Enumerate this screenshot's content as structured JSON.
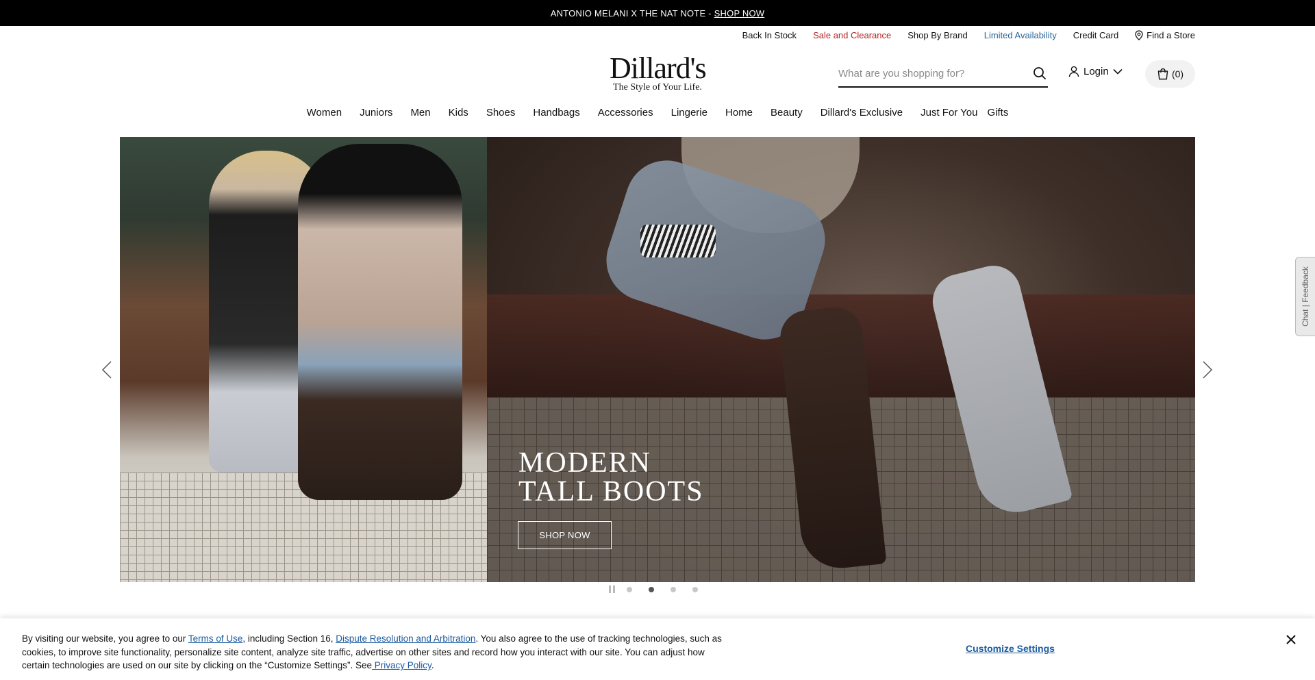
{
  "promo": {
    "text": "ANTONIO MELANI X THE NAT NOTE - ",
    "link": "SHOP NOW"
  },
  "utility": {
    "back_in_stock": "Back In Stock",
    "sale": "Sale and Clearance",
    "shop_by_brand": "Shop By Brand",
    "limited": "Limited Availability",
    "credit_card": "Credit Card",
    "find_store": "Find a Store"
  },
  "logo": {
    "wordmark": "Dillard's",
    "tagline": "The Style of Your Life."
  },
  "search": {
    "placeholder": "What are you shopping for?"
  },
  "account": {
    "login": "Login"
  },
  "cart": {
    "count": "(0)"
  },
  "nav": {
    "items": [
      "Women",
      "Juniors",
      "Men",
      "Kids",
      "Shoes",
      "Handbags",
      "Accessories",
      "Lingerie",
      "Home",
      "Beauty",
      "Dillard's Exclusive",
      "Just For You",
      "Gifts"
    ]
  },
  "hero": {
    "title_line1": "MODERN",
    "title_line2": "TALL BOOTS",
    "cta": "SHOP NOW",
    "active_slide": 2,
    "slide_count": 4
  },
  "feedback": {
    "label": "Chat | Feedback"
  },
  "cookie": {
    "t1": "By visiting our website, you agree to our ",
    "terms": "Terms of Use",
    "t2": ", including Section 16, ",
    "dispute": "Dispute Resolution and Arbitration",
    "t3": ". You also agree to the use of tracking technologies, such as cookies, to improve site functionality, personalize site content, analyze site traffic, advertise on other sites and record how you interact with our site. You can adjust how certain technologies are used on our site by clicking on the “Customize Settings”. See",
    "privacy": " Privacy Policy",
    "t4": ".",
    "customize": "Customize Settings"
  }
}
